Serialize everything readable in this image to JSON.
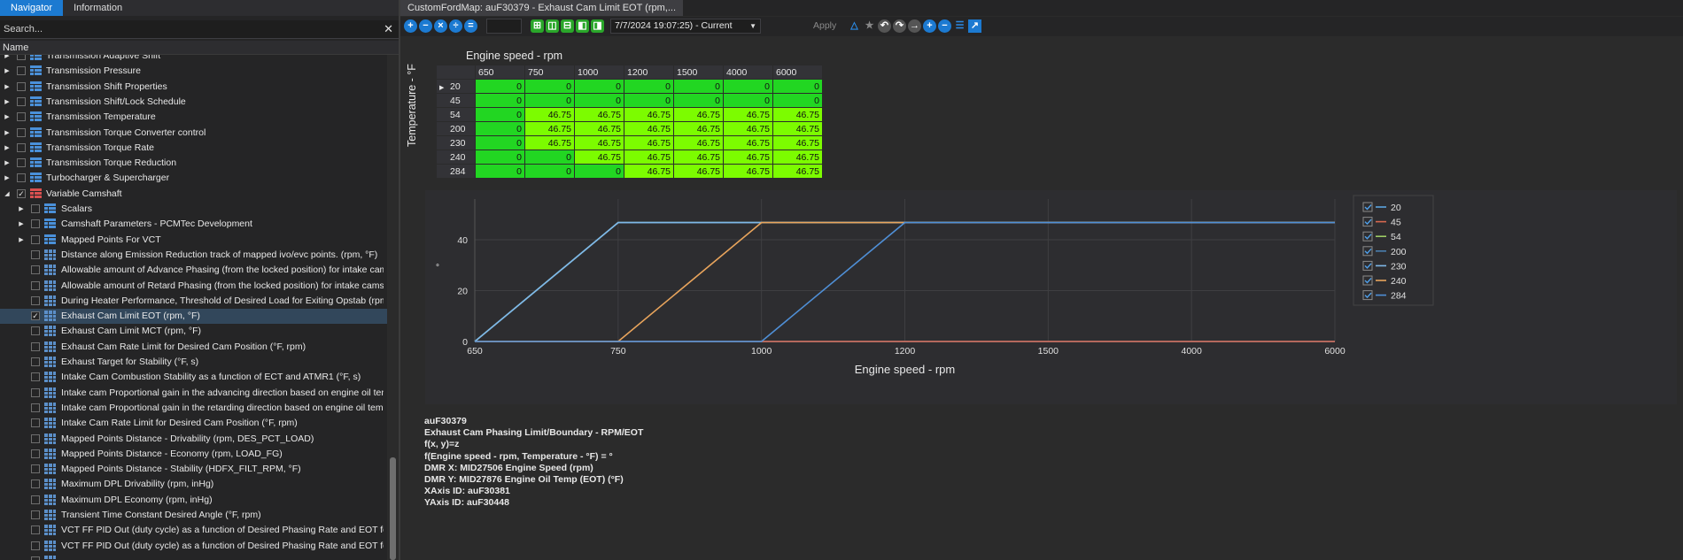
{
  "navigator": {
    "tabs": [
      "Navigator",
      "Information"
    ],
    "search_placeholder": "Search...",
    "column_header": "Name",
    "tree": [
      {
        "label": "Transmission Adaptive Shift",
        "type": "folder",
        "level": 1,
        "expand": true,
        "check": false
      },
      {
        "label": "Transmission Pressure",
        "type": "folder",
        "level": 1,
        "expand": true,
        "check": false
      },
      {
        "label": "Transmission Shift Properties",
        "type": "folder",
        "level": 1,
        "expand": true,
        "check": false
      },
      {
        "label": "Transmission Shift/Lock Schedule",
        "type": "folder",
        "level": 1,
        "expand": true,
        "check": false
      },
      {
        "label": "Transmission Temperature",
        "type": "folder",
        "level": 1,
        "expand": true,
        "check": false
      },
      {
        "label": "Transmission Torque Converter control",
        "type": "folder",
        "level": 1,
        "expand": true,
        "check": false
      },
      {
        "label": "Transmission Torque Rate",
        "type": "folder",
        "level": 1,
        "expand": true,
        "check": false
      },
      {
        "label": "Transmission Torque Reduction",
        "type": "folder",
        "level": 1,
        "expand": true,
        "check": false
      },
      {
        "label": "Turbocharger & Supercharger",
        "type": "folder",
        "level": 1,
        "expand": true,
        "check": false
      },
      {
        "label": "Variable Camshaft",
        "type": "folder-red",
        "level": 1,
        "expand": "open",
        "check": true
      },
      {
        "label": "Scalars",
        "type": "folder",
        "level": 2,
        "expand": true,
        "check": false
      },
      {
        "label": "Camshaft Parameters - PCMTec Development",
        "type": "folder",
        "level": 2,
        "expand": true,
        "check": false
      },
      {
        "label": "Mapped Points For VCT",
        "type": "folder",
        "level": 2,
        "expand": true,
        "check": false
      },
      {
        "label": "Distance  along Emission Reduction track of mapped ivo/evc points. (rpm, °F)",
        "type": "map",
        "level": 2,
        "expand": false,
        "check": false
      },
      {
        "label": "Allowable amount of Advance Phasing (from the locked position) for intake cam...",
        "type": "map",
        "level": 2,
        "expand": false,
        "check": false
      },
      {
        "label": "Allowable amount of Retard Phasing (from the locked position) for intake cams (...",
        "type": "map",
        "level": 2,
        "expand": false,
        "check": false
      },
      {
        "label": "During Heater Performance, Threshold of Desired Load for Exiting Opstab (rpm, i...",
        "type": "map",
        "level": 2,
        "expand": false,
        "check": false
      },
      {
        "label": "Exhaust Cam Limit EOT (rpm, °F)",
        "type": "map",
        "level": 2,
        "expand": false,
        "check": true,
        "selected": true
      },
      {
        "label": "Exhaust Cam Limit MCT (rpm, °F)",
        "type": "map",
        "level": 2,
        "expand": false,
        "check": false
      },
      {
        "label": "Exhaust Cam Rate Limit for Desired Cam Position (°F, rpm)",
        "type": "map",
        "level": 2,
        "expand": false,
        "check": false
      },
      {
        "label": "Exhaust Target for Stability (°F, s)",
        "type": "map",
        "level": 2,
        "expand": false,
        "check": false
      },
      {
        "label": "Intake Cam Combustion Stability as a function of ECT and ATMR1 (°F, s)",
        "type": "map",
        "level": 2,
        "expand": false,
        "check": false
      },
      {
        "label": "Intake cam Proportional gain in the advancing direction based on engine oil tem...",
        "type": "map",
        "level": 2,
        "expand": false,
        "check": false
      },
      {
        "label": "Intake cam Proportional gain in the retarding direction based on engine oil tem...",
        "type": "map",
        "level": 2,
        "expand": false,
        "check": false
      },
      {
        "label": "Intake Cam Rate Limit for Desired Cam Position (°F, rpm)",
        "type": "map",
        "level": 2,
        "expand": false,
        "check": false
      },
      {
        "label": "Mapped Points Distance - Drivability (rpm, DES_PCT_LOAD)",
        "type": "map",
        "level": 2,
        "expand": false,
        "check": false
      },
      {
        "label": "Mapped Points Distance - Economy (rpm, LOAD_FG)",
        "type": "map",
        "level": 2,
        "expand": false,
        "check": false
      },
      {
        "label": "Mapped Points Distance - Stability (HDFX_FILT_RPM, °F)",
        "type": "map",
        "level": 2,
        "expand": false,
        "check": false
      },
      {
        "label": "Maximum DPL Drivability (rpm, inHg)",
        "type": "map",
        "level": 2,
        "expand": false,
        "check": false
      },
      {
        "label": "Maximum DPL Economy (rpm, inHg)",
        "type": "map",
        "level": 2,
        "expand": false,
        "check": false
      },
      {
        "label": "Transient Time Constant Desired Angle (°F, rpm)",
        "type": "map",
        "level": 2,
        "expand": false,
        "check": false
      },
      {
        "label": "VCT FF PID Out (duty cycle) as a function of Desired Phasing Rate and EOT for Ex...",
        "type": "map",
        "level": 2,
        "expand": false,
        "check": false
      },
      {
        "label": "VCT FF PID Out (duty cycle) as a function of Desired Phasing Rate and EOT for Ex...",
        "type": "map",
        "level": 2,
        "expand": false,
        "check": false
      },
      {
        "label": "",
        "type": "map",
        "level": 2,
        "expand": false,
        "check": false
      }
    ]
  },
  "editor": {
    "tabs": [
      "CustomFordMap: auF30379 - Exhaust Cam Limit EOT (rpm,..."
    ],
    "toolbar": {
      "date_select": "7/7/2024 19:07:25) - Current",
      "apply_label": "Apply"
    },
    "table": {
      "x_axis_label": "Engine speed - rpm",
      "y_axis_label": "Temperature - °F",
      "columns": [
        "650",
        "750",
        "1000",
        "1200",
        "1500",
        "4000",
        "6000"
      ],
      "rows": [
        {
          "key": "20",
          "values": [
            "0",
            "0",
            "0",
            "0",
            "0",
            "0",
            "0"
          ]
        },
        {
          "key": "45",
          "values": [
            "0",
            "0",
            "0",
            "0",
            "0",
            "0",
            "0"
          ]
        },
        {
          "key": "54",
          "values": [
            "0",
            "46.75",
            "46.75",
            "46.75",
            "46.75",
            "46.75",
            "46.75"
          ]
        },
        {
          "key": "200",
          "values": [
            "0",
            "46.75",
            "46.75",
            "46.75",
            "46.75",
            "46.75",
            "46.75"
          ]
        },
        {
          "key": "230",
          "values": [
            "0",
            "46.75",
            "46.75",
            "46.75",
            "46.75",
            "46.75",
            "46.75"
          ]
        },
        {
          "key": "240",
          "values": [
            "0",
            "0",
            "46.75",
            "46.75",
            "46.75",
            "46.75",
            "46.75"
          ]
        },
        {
          "key": "284",
          "values": [
            "0",
            "0",
            "0",
            "46.75",
            "46.75",
            "46.75",
            "46.75"
          ]
        }
      ],
      "color_zero": "#22d622",
      "color_value": "#7cfc00"
    },
    "info": {
      "lines": [
        "auF30379",
        "Exhaust Cam Phasing Limit/Boundary - RPM/EOT",
        "f(x, y)=z",
        "f(Engine speed - rpm, Temperature - °F) = °",
        "DMR X: MID27506 Engine Speed (rpm)",
        "DMR Y: MID27876 Engine Oil Temp (EOT) (°F)",
        " XAxis ID: auF30381",
        " YAxis ID: auF30448"
      ]
    }
  },
  "chart_data": {
    "type": "line",
    "xlabel": "Engine speed - rpm",
    "ylabel": "°",
    "categories": [
      "650",
      "750",
      "1000",
      "1200",
      "1500",
      "4000",
      "6000"
    ],
    "y_ticks": [
      0,
      20,
      40
    ],
    "ylim": [
      0,
      50
    ],
    "grid": true,
    "legend_position": "right",
    "series": [
      {
        "name": "20",
        "color": "#5ba3e0",
        "values": [
          0,
          0,
          0,
          0,
          0,
          0,
          0
        ]
      },
      {
        "name": "45",
        "color": "#d9694f",
        "values": [
          0,
          0,
          0,
          0,
          0,
          0,
          0
        ]
      },
      {
        "name": "54",
        "color": "#9ccc65",
        "values": [
          0,
          46.75,
          46.75,
          46.75,
          46.75,
          46.75,
          46.75
        ]
      },
      {
        "name": "200",
        "color": "#4a7fb0",
        "values": [
          0,
          46.75,
          46.75,
          46.75,
          46.75,
          46.75,
          46.75
        ]
      },
      {
        "name": "230",
        "color": "#7fb8e8",
        "values": [
          0,
          46.75,
          46.75,
          46.75,
          46.75,
          46.75,
          46.75
        ]
      },
      {
        "name": "240",
        "color": "#e8a45c",
        "values": [
          0,
          0,
          46.75,
          46.75,
          46.75,
          46.75,
          46.75
        ]
      },
      {
        "name": "284",
        "color": "#4f8fd6",
        "values": [
          0,
          0,
          0,
          46.75,
          46.75,
          46.75,
          46.75
        ]
      }
    ]
  }
}
